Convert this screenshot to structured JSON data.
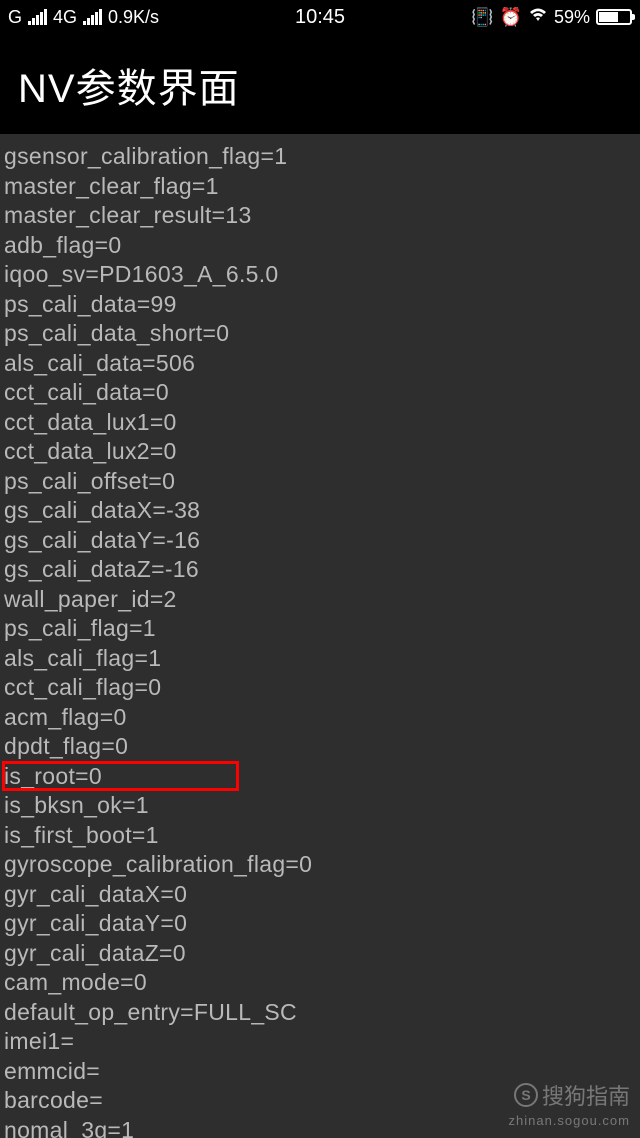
{
  "status_bar": {
    "carrier_prefix": "G",
    "network": "4G",
    "speed": "0.9K/s",
    "time": "10:45",
    "battery_pct": "59%"
  },
  "title": "NV参数界面",
  "lines": [
    "gsensor_calibration_flag=1",
    "master_clear_flag=1",
    "master_clear_result=13",
    "adb_flag=0",
    "iqoo_sv=PD1603_A_6.5.0",
    "ps_cali_data=99",
    "ps_cali_data_short=0",
    "als_cali_data=506",
    "cct_cali_data=0",
    "cct_data_lux1=0",
    "cct_data_lux2=0",
    "ps_cali_offset=0",
    "gs_cali_dataX=-38",
    "gs_cali_dataY=-16",
    "gs_cali_dataZ=-16",
    "wall_paper_id=2",
    "ps_cali_flag=1",
    "als_cali_flag=1",
    "cct_cali_flag=0",
    "acm_flag=0",
    "dpdt_flag=0",
    "is_root=0",
    "is_bksn_ok=1",
    "is_first_boot=1",
    "gyroscope_calibration_flag=0",
    "gyr_cali_dataX=0",
    "gyr_cali_dataY=0",
    "gyr_cali_dataZ=0",
    "cam_mode=0",
    "default_op_entry=FULL_SC",
    "imei1=",
    "emmcid=",
    "barcode=",
    "nomal_3g=1"
  ],
  "highlight_index": 21,
  "watermark": {
    "name": "搜狗指南",
    "url": "zhinan.sogou.com"
  }
}
